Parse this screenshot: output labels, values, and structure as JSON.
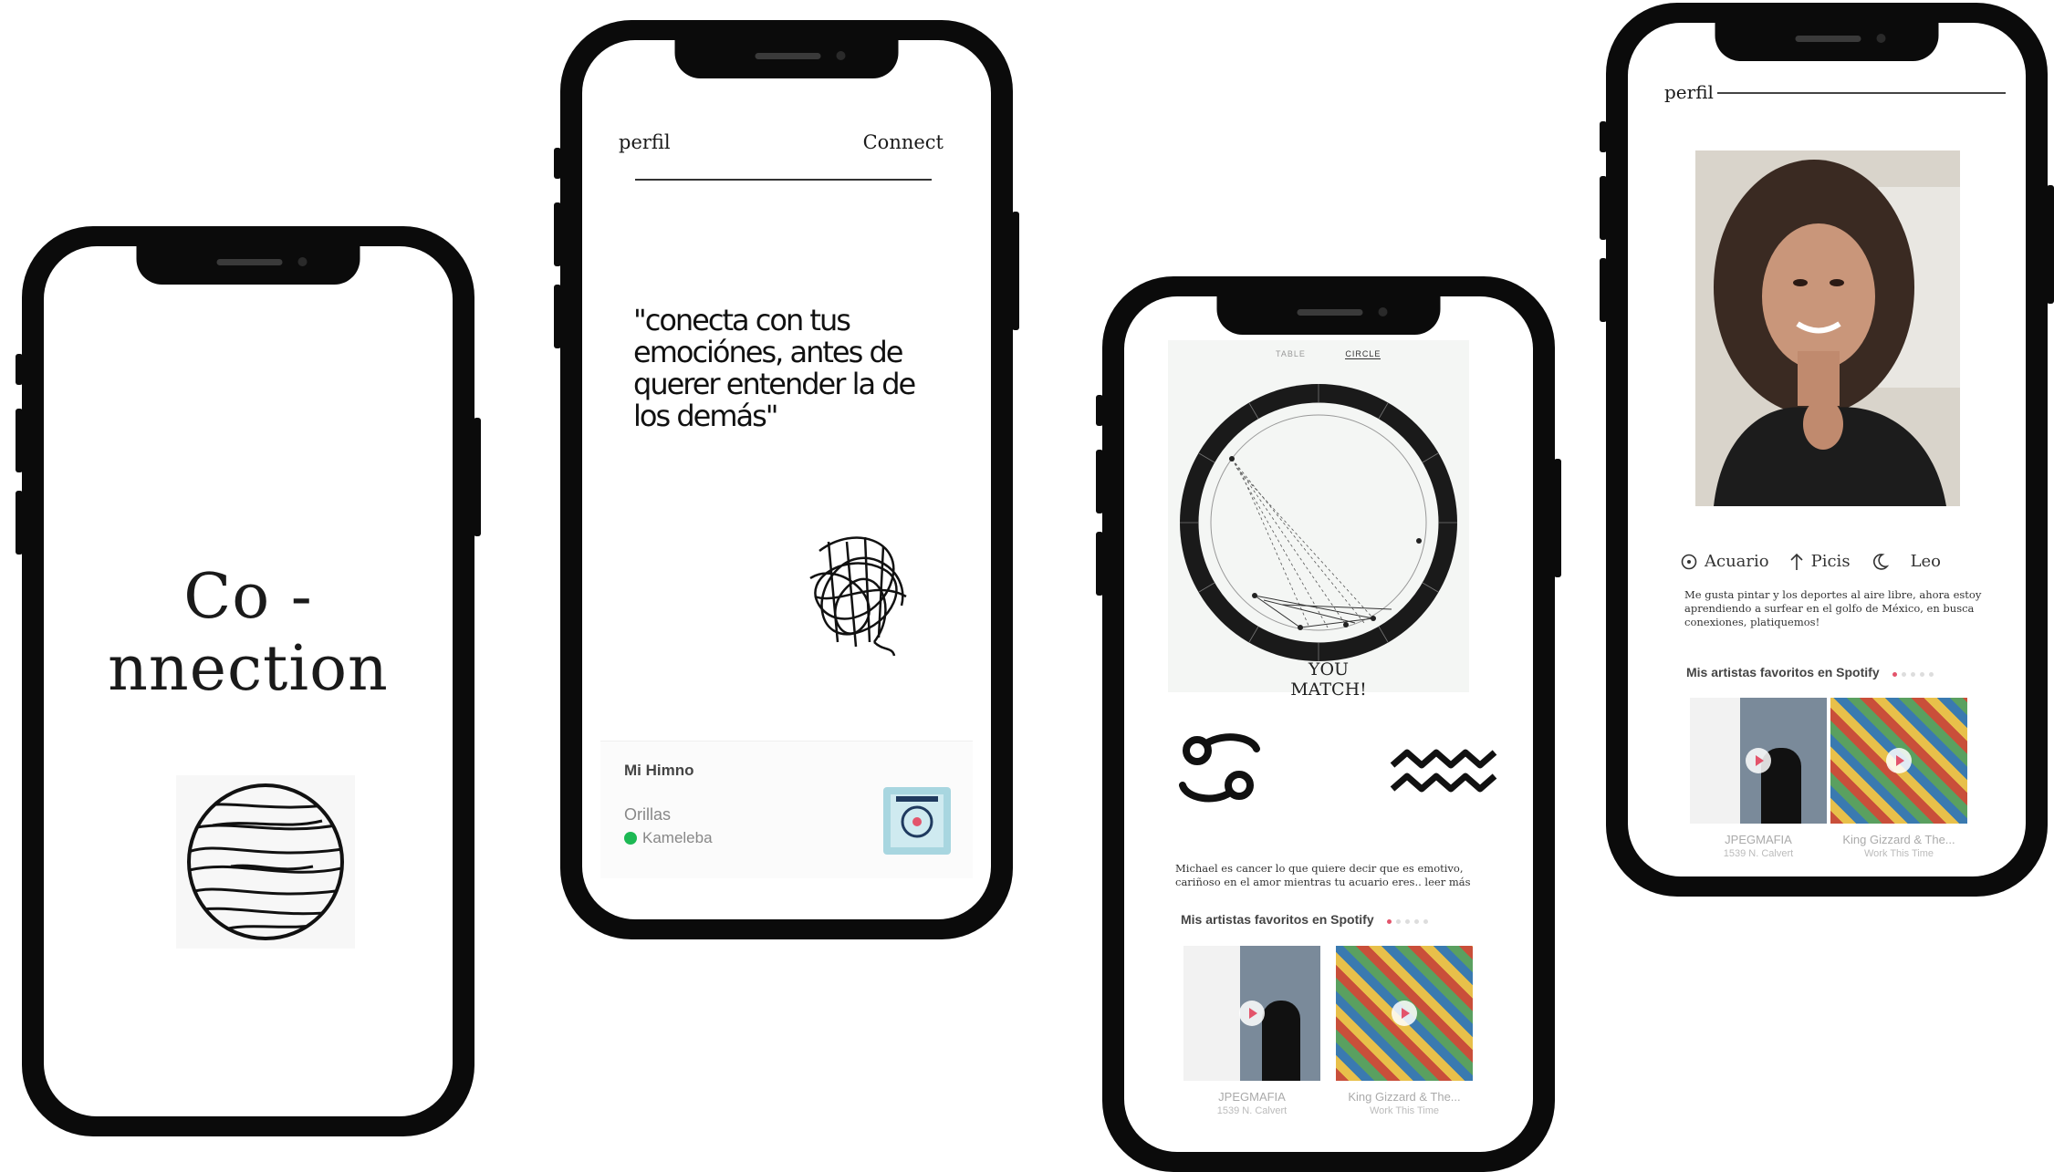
{
  "phone1": {
    "brand": "Co - nnection"
  },
  "phone2": {
    "header": {
      "left": "perfil",
      "right": "Connect"
    },
    "quote": "\"conecta con tus emociónes, antes de querer entender la de los demás\"",
    "anthem": {
      "title": "Mi Himno",
      "song": "Orillas",
      "artist": "Kameleba",
      "album_caption": "Kameleba"
    }
  },
  "phone3": {
    "tabs": [
      "TABLE",
      "CIRCLE"
    ],
    "match_line1": "YOU",
    "match_line2": "MATCH!",
    "description": "Michael es cancer lo que quiere decir que es emotivo, cariñoso en el amor mientras tu acuario eres.. leer más",
    "favorites_title": "Mis artistas favoritos en Spotify",
    "cards": [
      {
        "name": "JPEGMAFIA",
        "sub": "1539 N. Calvert"
      },
      {
        "name": "King Gizzard & The...",
        "sub": "Work This Time"
      }
    ]
  },
  "phone4": {
    "header": "perfil",
    "signs": [
      {
        "label": "Acuario",
        "icon": "sun-icon"
      },
      {
        "label": "Picis",
        "icon": "rising-arrow-icon"
      },
      {
        "label": "Leo",
        "icon": "moon-icon"
      }
    ],
    "bio": "Me gusta pintar y los deportes al aire libre, ahora estoy aprendiendo a surfear en el golfo de México, en busca conexiones, platiquemos!",
    "favorites_title": "Mis artistas favoritos en Spotify",
    "cards": [
      {
        "name": "JPEGMAFIA",
        "sub": "1539 N. Calvert"
      },
      {
        "name": "King Gizzard & The...",
        "sub": "Work This Time"
      }
    ]
  },
  "colors": {
    "accent": "#e3546b",
    "spotify": "#1db954",
    "phone_frame": "#0b0b0b"
  }
}
